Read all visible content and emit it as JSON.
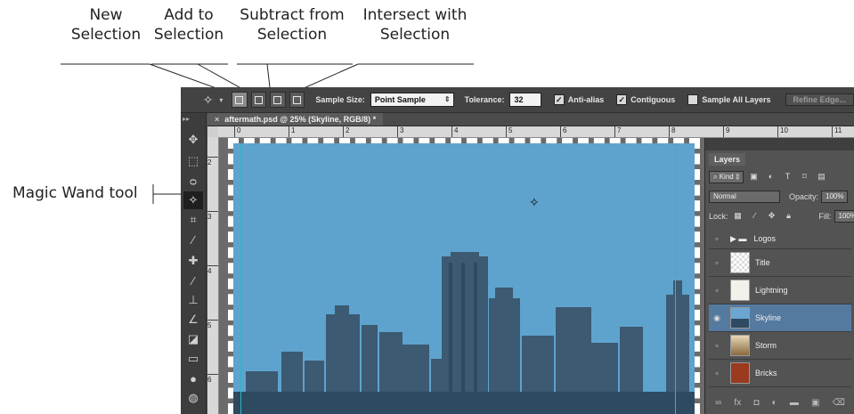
{
  "callouts": {
    "new_selection": [
      "New",
      "Selection"
    ],
    "add_to_selection": [
      "Add to",
      "Selection"
    ],
    "subtract_from_selection": [
      "Subtract from",
      "Selection"
    ],
    "intersect_with_selection": [
      "Intersect with",
      "Selection"
    ],
    "magic_wand": "Magic Wand tool"
  },
  "options_bar": {
    "sample_size_label": "Sample Size:",
    "sample_size_value": "Point Sample",
    "tolerance_label": "Tolerance:",
    "tolerance_value": "32",
    "anti_alias_label": "Anti-alias",
    "anti_alias_checked": true,
    "contiguous_label": "Contiguous",
    "contiguous_checked": true,
    "sample_all_layers_label": "Sample All Layers",
    "sample_all_layers_checked": false,
    "refine_edge_label": "Refine Edge..."
  },
  "document": {
    "tab_title": "aftermath.psd @ 25% (Skyline, RGB/8) *",
    "h_ruler_ticks": [
      "0",
      "1",
      "2",
      "3",
      "4",
      "5",
      "6",
      "7",
      "8",
      "9",
      "10",
      "11"
    ],
    "v_ruler_ticks": [
      "2",
      "3",
      "4",
      "5",
      "6"
    ]
  },
  "layers_panel": {
    "tab_label": "Layers",
    "filter_kind": "Kind",
    "blend_mode": "Normal",
    "opacity_label": "Opacity:",
    "opacity_value": "100%",
    "lock_label": "Lock:",
    "fill_label": "Fill:",
    "fill_value": "100%",
    "layers": [
      {
        "name": "Logos",
        "type": "group",
        "visible": false,
        "selected": false
      },
      {
        "name": "Title",
        "visible": false,
        "selected": false
      },
      {
        "name": "Lightning",
        "visible": false,
        "selected": false
      },
      {
        "name": "Skyline",
        "visible": true,
        "selected": true
      },
      {
        "name": "Storm",
        "visible": false,
        "selected": false
      },
      {
        "name": "Bricks",
        "visible": false,
        "selected": false
      }
    ]
  },
  "colors": {
    "sky": "#5ea3cd",
    "guide": "#29b6c8",
    "selected_layer": "#557aa0"
  }
}
